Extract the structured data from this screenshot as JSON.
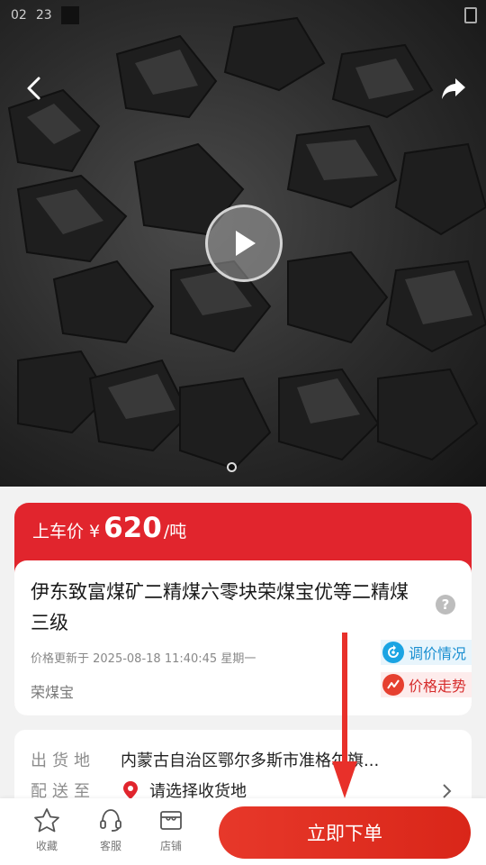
{
  "status_bar": {
    "time": "02",
    "extra": "23"
  },
  "header": {
    "back_icon": "chevron-left-icon",
    "share_icon": "share-arrow-icon",
    "play_icon": "play-icon"
  },
  "price": {
    "label": "上车价",
    "currency": "¥",
    "value": "620",
    "unit": "/吨"
  },
  "product": {
    "title": "伊东致富煤矿二精煤六零块荣煤宝优等二精煤三级",
    "updated": "价格更新于 2025-08-18 11:40:45 星期一",
    "brand": "荣煤宝",
    "help_icon": "?",
    "tag_adjust": "调价情况",
    "tag_trend": "价格走势"
  },
  "shipping": {
    "origin_label": "出货地",
    "origin_value": "内蒙古自治区鄂尔多斯市准格尔旗...",
    "dest_label": "配送至",
    "dest_value": "请选择收货地"
  },
  "bottom_bar": {
    "favorite": "收藏",
    "service": "客服",
    "shop": "店铺",
    "order_button": "立即下单"
  },
  "colors": {
    "accent_red": "#e1252d",
    "tag_blue": "#1ba4e3",
    "tag_red": "#e64030"
  }
}
